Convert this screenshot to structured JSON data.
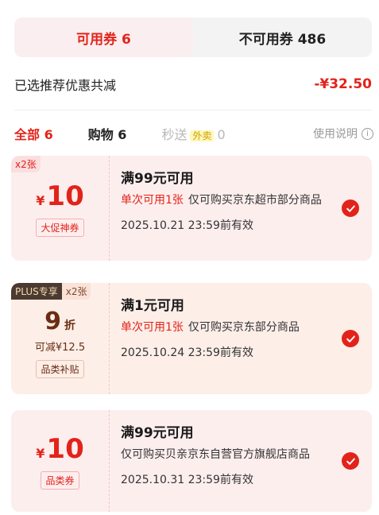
{
  "tabs": {
    "available": "可用券 6",
    "unavailable": "不可用券 486"
  },
  "summary": {
    "label": "已选推荐优惠共减",
    "value": "-¥32.50"
  },
  "filters": {
    "all": "全部 6",
    "shopping": "购物 6",
    "instant_pre": "秒送",
    "takeout_tag": "外卖",
    "instant_count": "0",
    "help": "使用说明"
  },
  "coupons": [
    {
      "qty": "x2张",
      "currency": "¥",
      "amount": "10",
      "badge": "大促神券",
      "title": "满99元可用",
      "highlight": "单次可用1张",
      "desc": "仅可购买京东超市部分商品",
      "expiry": "2025.10.21 23:59前有效"
    },
    {
      "plus_label": "PLUS专享",
      "qty": "x2张",
      "discount": "9",
      "discount_unit": "折",
      "save": "可减¥12.5",
      "badge": "品类补贴",
      "title": "满1元可用",
      "highlight": "单次可用1张",
      "desc": "仅可购买京东部分商品",
      "expiry": "2025.10.24 23:59前有效"
    },
    {
      "currency": "¥",
      "amount": "10",
      "badge": "品类券",
      "title": "满99元可用",
      "desc": "仅可购买贝亲京东自营官方旗舰店商品",
      "expiry": "2025.10.31 23:59前有效"
    }
  ],
  "colors": {
    "accent": "#e2231a",
    "card_bg": "#fdeeee",
    "plus_dark": "#4b3a30"
  }
}
